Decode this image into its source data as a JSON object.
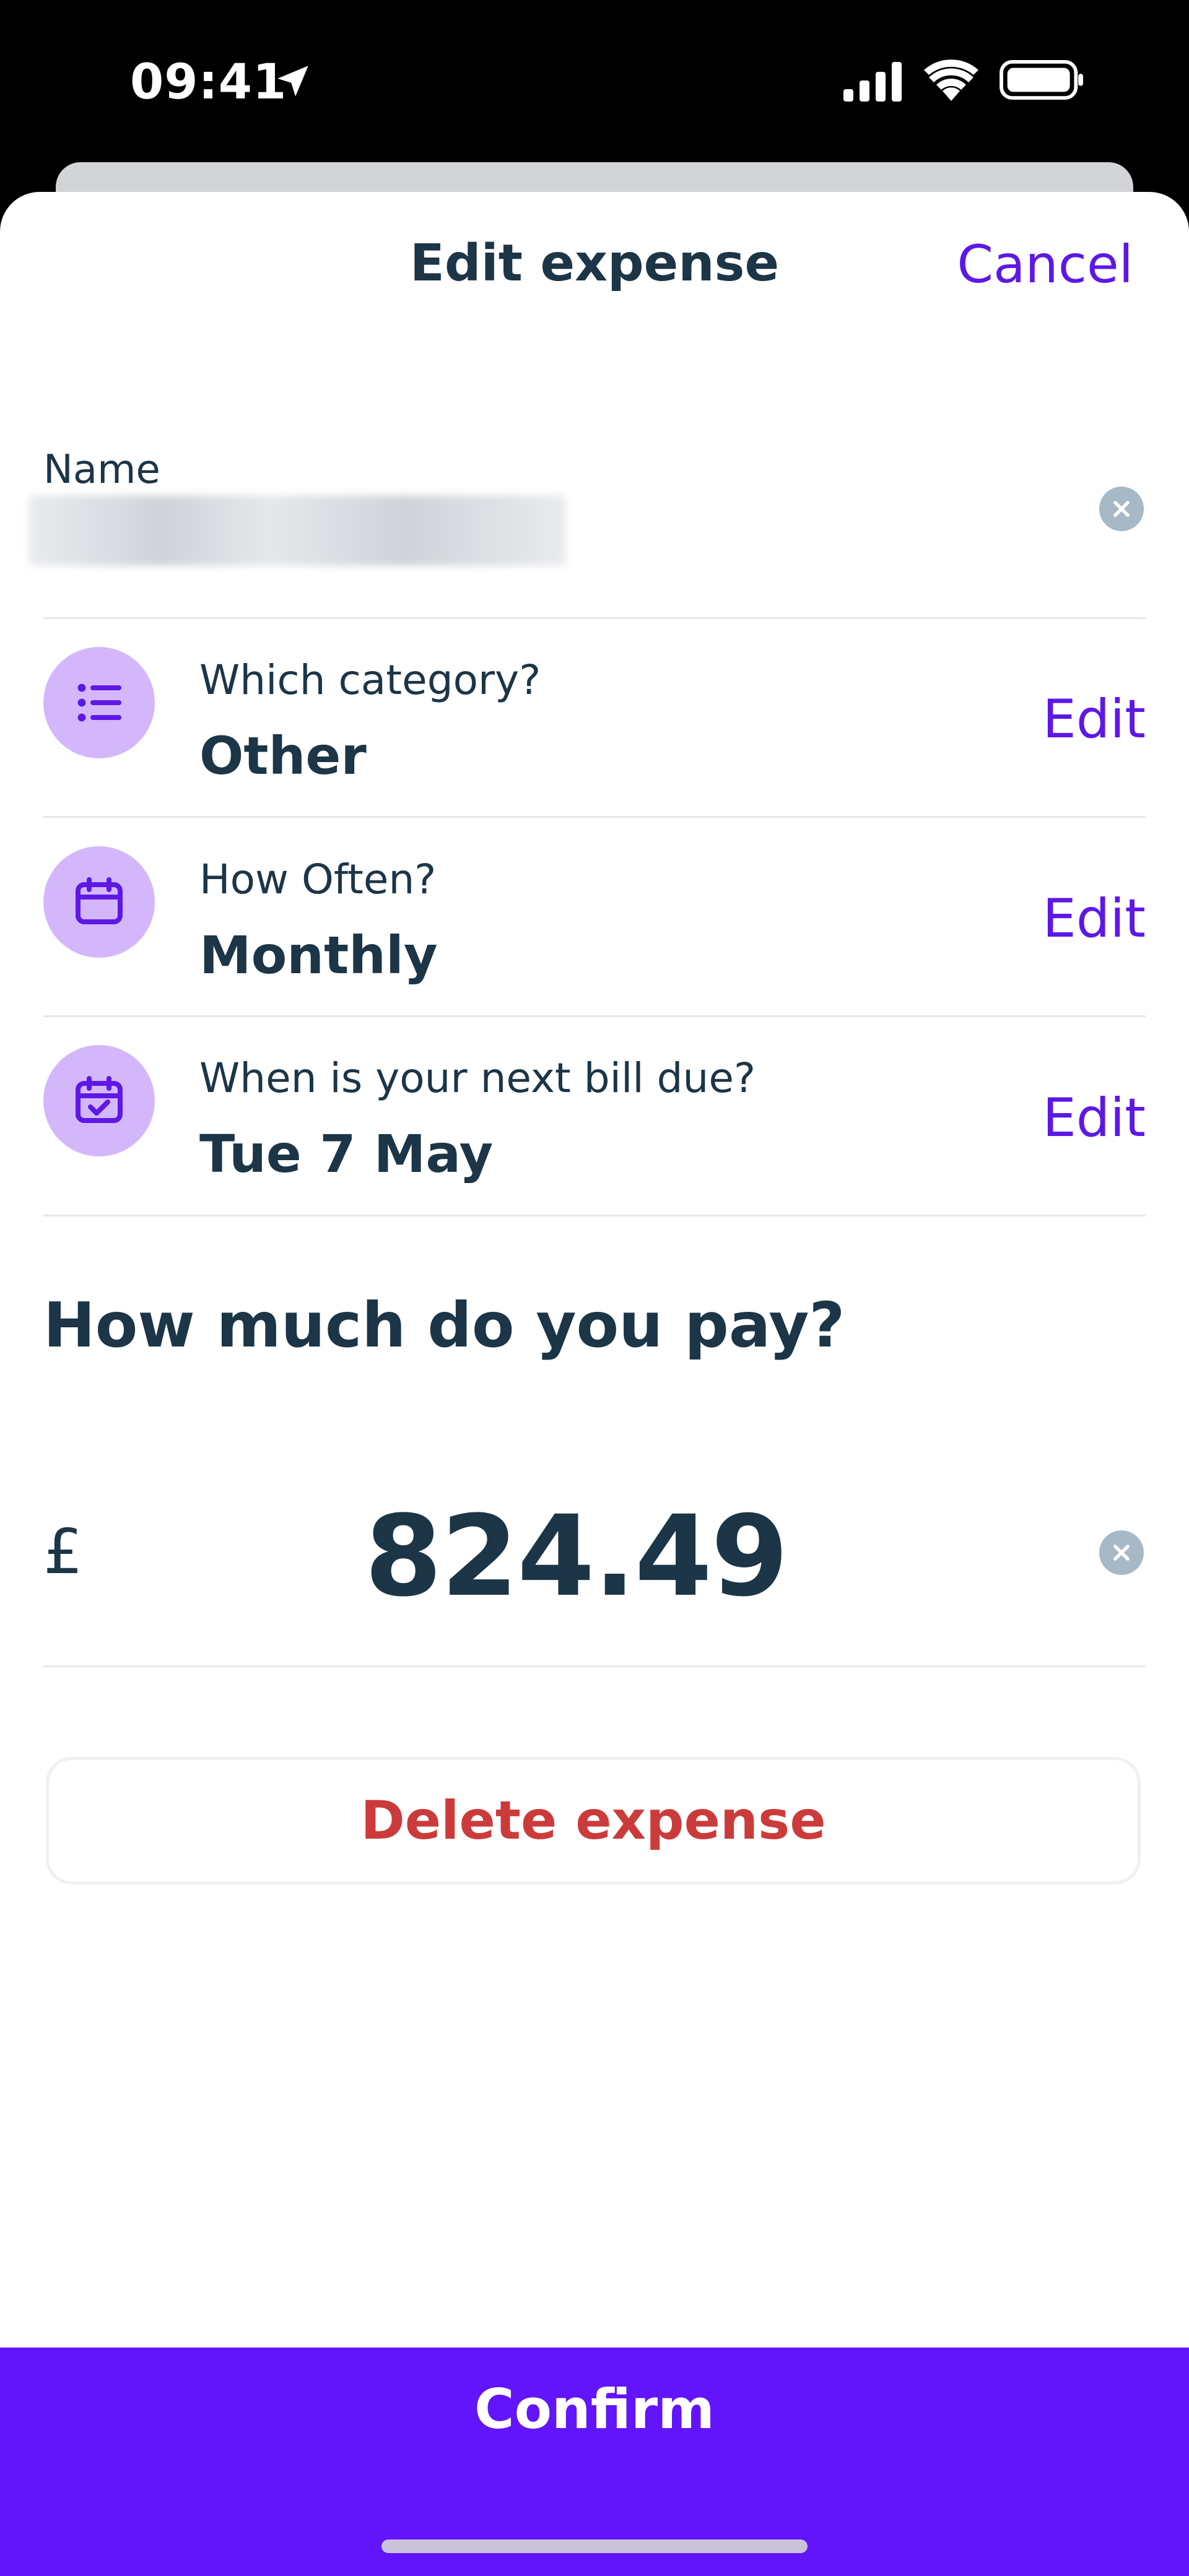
{
  "status_bar": {
    "time": "09:41"
  },
  "header": {
    "title": "Edit expense",
    "cancel_label": "Cancel"
  },
  "name_field": {
    "label": "Name"
  },
  "rows": [
    {
      "label": "Which category?",
      "value": "Other",
      "edit_label": "Edit",
      "icon": "list-icon"
    },
    {
      "label": "How Often?",
      "value": "Monthly",
      "edit_label": "Edit",
      "icon": "calendar-icon"
    },
    {
      "label": "When is your next bill due?",
      "value": "Tue 7 May",
      "edit_label": "Edit",
      "icon": "calendar-check-icon"
    }
  ],
  "amount_section": {
    "title": "How much do you pay?",
    "currency": "£",
    "amount": "824.49"
  },
  "delete_button": {
    "label": "Delete expense"
  },
  "confirm_button": {
    "label": "Confirm"
  },
  "colors": {
    "accent": "#6214fb",
    "link": "#5d18e6",
    "icon_bg": "#d4b7fb",
    "text": "#1c3547",
    "danger": "#cc3b3b"
  }
}
